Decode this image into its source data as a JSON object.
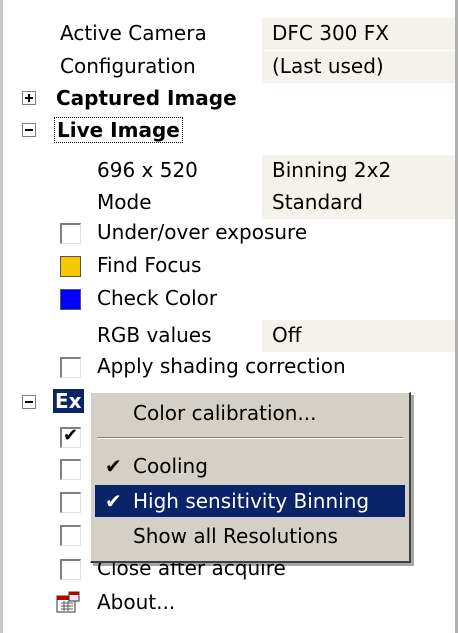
{
  "tree": {
    "active_camera": {
      "label": "Active Camera",
      "value": "DFC 300 FX"
    },
    "configuration": {
      "label": "Configuration",
      "value": "(Last used)"
    },
    "captured_image": {
      "label": "Captured Image",
      "expander": "+"
    },
    "live_image": {
      "label": "Live Image",
      "expander": "−"
    },
    "resolution": {
      "label": "696 x 520",
      "value": "Binning 2x2"
    },
    "mode": {
      "label": "Mode",
      "value": "Standard"
    },
    "under_over": {
      "label": "Under/over exposure",
      "checked": false
    },
    "find_focus": {
      "label": "Find Focus",
      "color": "#f8c800"
    },
    "check_color": {
      "label": "Check Color",
      "color": "#0000ff"
    },
    "rgb_values": {
      "label": "RGB values",
      "value": "Off"
    },
    "shading": {
      "label": "Apply shading correction",
      "checked": false
    },
    "extra": {
      "label": "Ex",
      "expander": "−"
    },
    "extra_rows": [
      {
        "checked": true
      },
      {
        "checked": false
      },
      {
        "checked": false
      },
      {
        "checked": false
      }
    ],
    "close_after": {
      "label": "Close after acquire",
      "checked": false
    },
    "about": {
      "label": "About...",
      "icon": "calendar-dialog-icon"
    }
  },
  "context_menu": {
    "items": [
      {
        "label": "Color calibration...",
        "checked": false
      },
      {
        "label": "Cooling",
        "checked": true
      },
      {
        "label": "High sensitivity Binning",
        "checked": true,
        "highlighted": true
      },
      {
        "label": "Show all Resolutions",
        "checked": false
      }
    ],
    "check_glyph": "✔"
  },
  "colors": {
    "selection": "#0a246a",
    "value_bg": "#f4f2ea",
    "menu_bg": "#d4d0c8"
  }
}
